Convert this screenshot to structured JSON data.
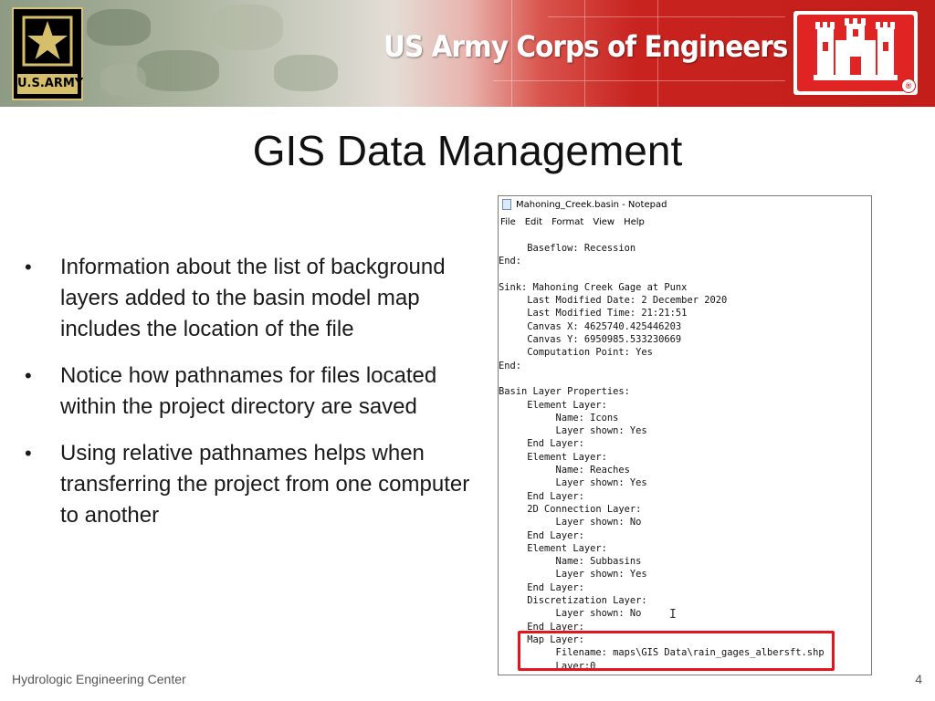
{
  "banner": {
    "army_logo_text": "U.S.ARMY",
    "organization_title": "US Army Corps of Engineers",
    "registered_mark": "®"
  },
  "slide": {
    "title": "GIS Data Management",
    "bullets": [
      "Information about the list of background layers added to the basin model map includes the location of the file",
      "Notice how pathnames for files located within the project directory are saved",
      "Using relative pathnames helps when transferring the project from one computer to another"
    ],
    "bullet_symbol": "•"
  },
  "notepad": {
    "window_title": "Mahoning_Creek.basin - Notepad",
    "menu": [
      "File",
      "Edit",
      "Format",
      "View",
      "Help"
    ],
    "lines": [
      "     Baseflow: Recession",
      "End:",
      "",
      "Sink: Mahoning Creek Gage at Punx",
      "     Last Modified Date: 2 December 2020",
      "     Last Modified Time: 21:21:51",
      "     Canvas X: 4625740.425446203",
      "     Canvas Y: 6950985.533230669",
      "     Computation Point: Yes",
      "End:",
      "",
      "Basin Layer Properties:",
      "     Element Layer:",
      "          Name: Icons",
      "          Layer shown: Yes",
      "     End Layer:",
      "     Element Layer:",
      "          Name: Reaches",
      "          Layer shown: Yes",
      "     End Layer:",
      "     2D Connection Layer:",
      "          Layer shown: No",
      "     End Layer:",
      "     Element Layer:",
      "          Name: Subbasins",
      "          Layer shown: Yes",
      "     End Layer:",
      "     Discretization Layer:",
      "          Layer shown: No",
      "     End Layer:",
      "     Map Layer:",
      "          Filename: maps\\GIS Data\\rain_gages_albersft.shp",
      "          Layer:0"
    ],
    "cursor_glyph": "I",
    "highlight_color": "#e8141c"
  },
  "footer": {
    "organization": "Hydrologic Engineering Center",
    "page_number": "4"
  },
  "colors": {
    "banner_red": "#c41e1a",
    "army_gold": "#d6bf6a"
  }
}
